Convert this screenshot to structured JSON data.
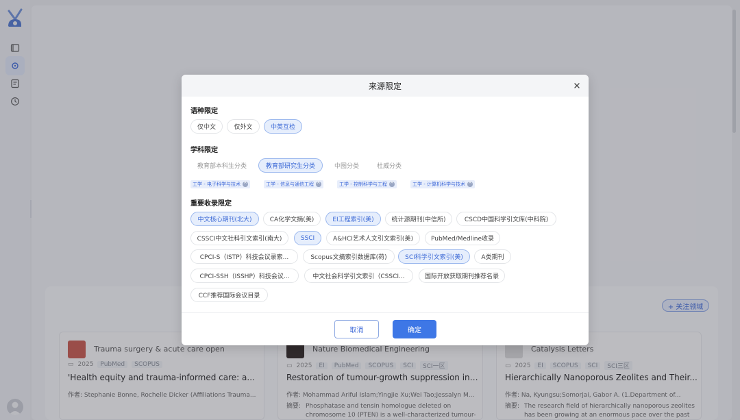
{
  "background": {
    "follow_button": "+ 关注领域",
    "cards": [
      {
        "journal": "Trauma surgery & acute care open",
        "year": "2025",
        "tags": [
          "PubMed",
          "SCOPUS"
        ],
        "title": "'Health equity and trauma-informed care: a...",
        "authors": "作者: Stephanie Bonne, Rochelle Dicker (Affiliations Trauma...",
        "abstract_label": "",
        "abstract": ""
      },
      {
        "journal": "Nature Biomedical Engineering",
        "year": "2025",
        "tags": [
          "EI",
          "PubMed",
          "SCOPUS",
          "SCI",
          "SCI一区"
        ],
        "title": "Restoration of tumour-growth suppression in vi...",
        "authors": "作者: Mohammad Ariful Islam;Yingjie Xu;Wei Tao;Jessalyn M...",
        "abstract_label": "摘要:",
        "abstract": "Phosphatase and tensin homologue deleted on chromosome 10 (PTEN) is a well-characterized tumour-"
      },
      {
        "journal": "Catalysis Letters",
        "year": "2025",
        "tags": [
          "EI",
          "SCOPUS",
          "SCI",
          "SCI三区"
        ],
        "title": "Hierarchically Nanoporous Zeolites and Their...",
        "authors": "作者: Na, Kyungsu;Somorjai, Gabor A. (1.Department of...",
        "abstract_label": "摘要:",
        "abstract": "The research field of hierarchically nanoporous zeolites has been growing at an enormous pace over the past"
      }
    ]
  },
  "modal": {
    "title": "来源限定",
    "language": {
      "title": "语种限定",
      "options": [
        "仅中文",
        "仅外文",
        "中英互检"
      ]
    },
    "subject": {
      "title": "学科限定",
      "options": [
        "教育部本科生分类",
        "教育部研究生分类",
        "中图分类",
        "杜威分类"
      ],
      "selected_tags": [
        "工学 - 电子科学与技术",
        "工学 - 信息与通信工程",
        "工学 - 控制科学与工程",
        "工学 - 计算机科学与技术"
      ]
    },
    "collection": {
      "title": "重要收录限定",
      "options": [
        "中文核心期刊(北大)",
        "CA化学文摘(美)",
        "EI工程索引(美)",
        "统计源期刊(中信所)",
        "CSCD中国科学引文库(中科院)",
        "CSSCI中文社科引文索引(南大)",
        "SSCI",
        "A&HCI艺术人文引文索引(美)",
        "PubMed/Medline收录",
        "CPCI-S（ISTP）科技会议录索...",
        "Scopus文摘索引数据库(荷)",
        "SCI科学引文索引(美)",
        "A类期刊",
        "CPCI-SSH（ISSHP）科技会议...",
        "中文社会科学引文索引（CSSCI...",
        "国际开放获取期刊推荐名录",
        "CCF推荐国际会议目录"
      ]
    },
    "cancel": "取消",
    "confirm": "确定"
  }
}
